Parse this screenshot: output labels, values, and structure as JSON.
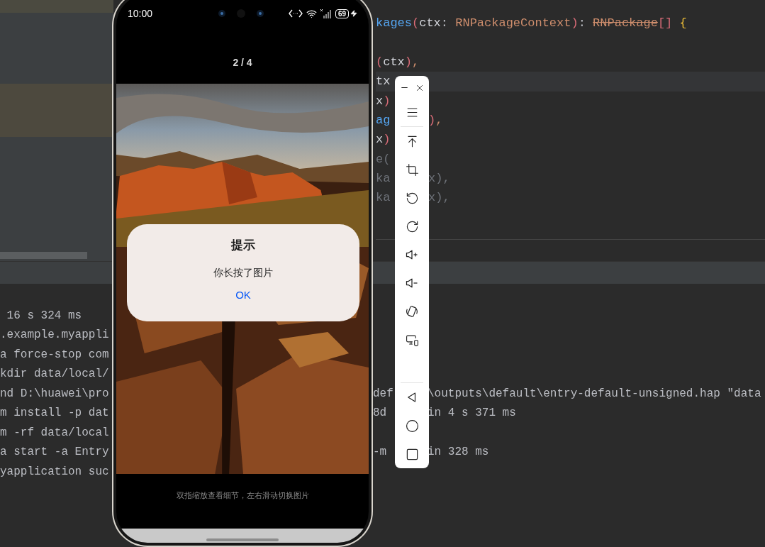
{
  "editor": {
    "lines": [
      {
        "current": false,
        "tokens": [
          {
            "text": "kages",
            "kind": "fn"
          },
          {
            "text": "(",
            "kind": "paren"
          },
          {
            "text": "ctx",
            "kind": "ident"
          },
          {
            "text": ": ",
            "kind": "punct"
          },
          {
            "text": "RNPackageContext",
            "kind": "type"
          },
          {
            "text": ")",
            "kind": "paren"
          },
          {
            "text": ": ",
            "kind": "punct"
          },
          {
            "text": "RNPackage",
            "kind": "deprecated"
          },
          {
            "text": "[]",
            "kind": "paren"
          },
          {
            "text": " {",
            "kind": "brace"
          }
        ]
      },
      {
        "current": false,
        "tokens": [
          {
            "text": "(",
            "kind": "paren"
          },
          {
            "text": "ctx",
            "kind": "ident"
          },
          {
            "text": ")",
            "kind": "paren"
          },
          {
            "text": ",",
            "kind": "comma"
          }
        ]
      },
      {
        "current": true,
        "tokens": [
          {
            "text": "tx",
            "kind": "ident"
          }
        ]
      },
      {
        "current": false,
        "tokens": [
          {
            "text": "x",
            "kind": "ident"
          },
          {
            "text": ")",
            "kind": "paren"
          }
        ]
      },
      {
        "current": false,
        "tokens": [
          {
            "text": "ag",
            "kind": "fn"
          }
        ],
        "tail": [
          {
            "text": ")",
            "kind": "paren"
          },
          {
            "text": ",",
            "kind": "comma"
          }
        ]
      },
      {
        "current": false,
        "tokens": [
          {
            "text": "x",
            "kind": "ident"
          },
          {
            "text": ")",
            "kind": "paren"
          }
        ]
      },
      {
        "current": false,
        "tokens": [
          {
            "text": "e(",
            "kind": "dim"
          }
        ]
      },
      {
        "current": false,
        "tokens": [
          {
            "text": "ka",
            "kind": "dim"
          }
        ],
        "tail": [
          {
            "text": "x),",
            "kind": "dim"
          }
        ]
      },
      {
        "current": false,
        "tokens": [
          {
            "text": "ka",
            "kind": "dim"
          }
        ],
        "tail": [
          {
            "text": "x),",
            "kind": "dim"
          }
        ]
      }
    ]
  },
  "console": {
    "lines": [
      {
        "left": " 16 s 324 ms"
      },
      {
        "left": ".example.myappli"
      },
      {
        "left": "a force-stop com"
      },
      {
        "left": "kdir data/local/"
      },
      {
        "left": "nd D:\\huawei\\pro",
        "right": "def",
        "tail": "\\outputs\\default\\entry-default-unsigned.hap \"data"
      },
      {
        "left": "m install -p dat",
        "right": "8d",
        "tail": "in 4 s 371 ms"
      },
      {
        "left": "m -rf data/local"
      },
      {
        "left": "a start -a Entry",
        "right": "-m",
        "tail": "in 328 ms"
      },
      {
        "left": "yapplication suc"
      }
    ]
  },
  "phone": {
    "status_bar": {
      "time": "10:00",
      "battery": "69"
    },
    "counter": "2 / 4",
    "dialog": {
      "title": "提示",
      "message": "你长按了图片",
      "button": "OK"
    },
    "hint": "双指缩放查看细节，左右滑动切换图片"
  }
}
